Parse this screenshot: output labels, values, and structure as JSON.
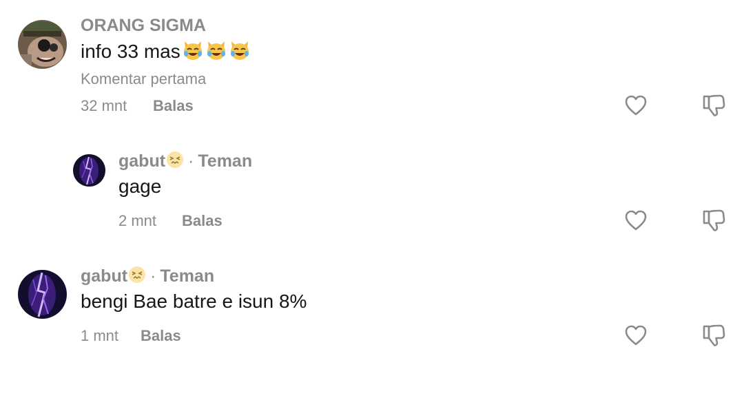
{
  "comments": [
    {
      "username": "ORANG SIGMA",
      "text": "info 33 mas",
      "emoji": [
        "cat-tears-of-joy",
        "cat-tears-of-joy",
        "cat-tears-of-joy"
      ],
      "note": "Komentar pertama",
      "time": "32 mnt",
      "reply_label": "Balas"
    },
    {
      "username": "gabut",
      "name_emoji": "confounded-face",
      "relation": "Teman",
      "text": "gage",
      "time": "2 mnt",
      "reply_label": "Balas"
    },
    {
      "username": "gabut",
      "name_emoji": "confounded-face",
      "relation": "Teman",
      "text": "bengi Bae batre e isun 8%",
      "time": "1 mnt",
      "reply_label": "Balas"
    }
  ],
  "icons": {
    "like": "heart-outline-icon",
    "dislike": "thumbs-down-outline-icon"
  },
  "colors": {
    "secondary_text": "#8a8a8a",
    "primary_text": "#161616",
    "background": "#ffffff"
  }
}
